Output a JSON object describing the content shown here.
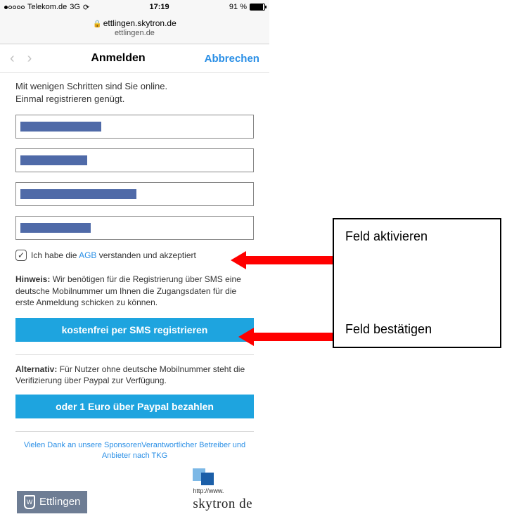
{
  "status": {
    "carrier": "Telekom.de",
    "network": "3G",
    "time": "17:19",
    "battery_pct": "91 %"
  },
  "urlbar": {
    "host": "ettlingen.skytron.de",
    "sub": "ettlingen.de"
  },
  "nav": {
    "title": "Anmelden",
    "cancel": "Abbrechen"
  },
  "intro": {
    "line1": "Mit wenigen Schritten sind Sie online.",
    "line2": "Einmal registrieren genügt."
  },
  "agb": {
    "pre": "Ich habe die",
    "link": "AGB",
    "post": "verstanden und akzeptiert"
  },
  "hint": {
    "label": "Hinweis:",
    "text": "Wir benötigen für die Registrierung über SMS eine deutsche Mobilnummer um Ihnen die Zugangsdaten für die erste Anmeldung schicken zu können."
  },
  "btn_sms": "kostenfrei per SMS registrieren",
  "alt": {
    "label": "Alternativ:",
    "text": "Für Nutzer ohne deutsche Mobilnummer steht die Verifizierung über Paypal zur Verfügung."
  },
  "btn_paypal": "oder 1 Euro über Paypal bezahlen",
  "thanks": "Vielen Dank an unsere SponsorenVerantwortlicher Betreiber und Anbieter nach TKG",
  "logos": {
    "ettlingen": "Ettlingen",
    "skytron_url": "http://www.",
    "skytron_name": "skytron de"
  },
  "annotations": {
    "a1": "Feld aktivieren",
    "a2": "Feld bestätigen"
  }
}
